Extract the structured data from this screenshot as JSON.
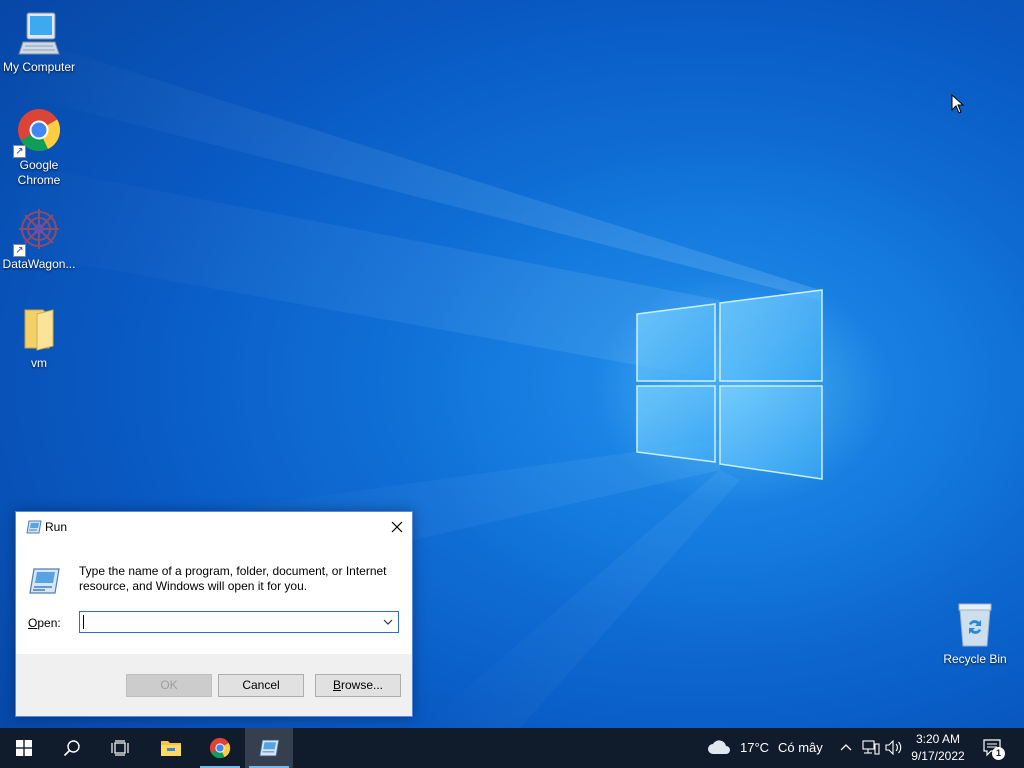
{
  "desktop": {
    "icons": [
      {
        "label": "My Computer",
        "icon": "computer-icon"
      },
      {
        "label": "Google Chrome",
        "icon": "chrome-icon"
      },
      {
        "label": "DataWagon...",
        "icon": "datawagon-icon"
      },
      {
        "label": "vm",
        "icon": "folder-icon"
      },
      {
        "label": "Recycle Bin",
        "icon": "recycle-bin-icon"
      }
    ]
  },
  "run_dialog": {
    "title": "Run",
    "description": "Type the name of a program, folder, document, or Internet resource, and Windows will open it for you.",
    "open_label_accel": "O",
    "open_label_rest": "pen:",
    "open_value": "",
    "ok_label": "OK",
    "cancel_label": "Cancel",
    "browse_accel": "B",
    "browse_rest": "rowse..."
  },
  "taskbar": {
    "weather_temp": "17°C",
    "weather_text": "Có mây",
    "time": "3:20 AM",
    "date": "9/17/2022",
    "notification_count": "1"
  },
  "colors": {
    "taskbar_bg": "#101b2c",
    "accent": "#76b9ed",
    "wallpaper": "#0f6fd6"
  }
}
